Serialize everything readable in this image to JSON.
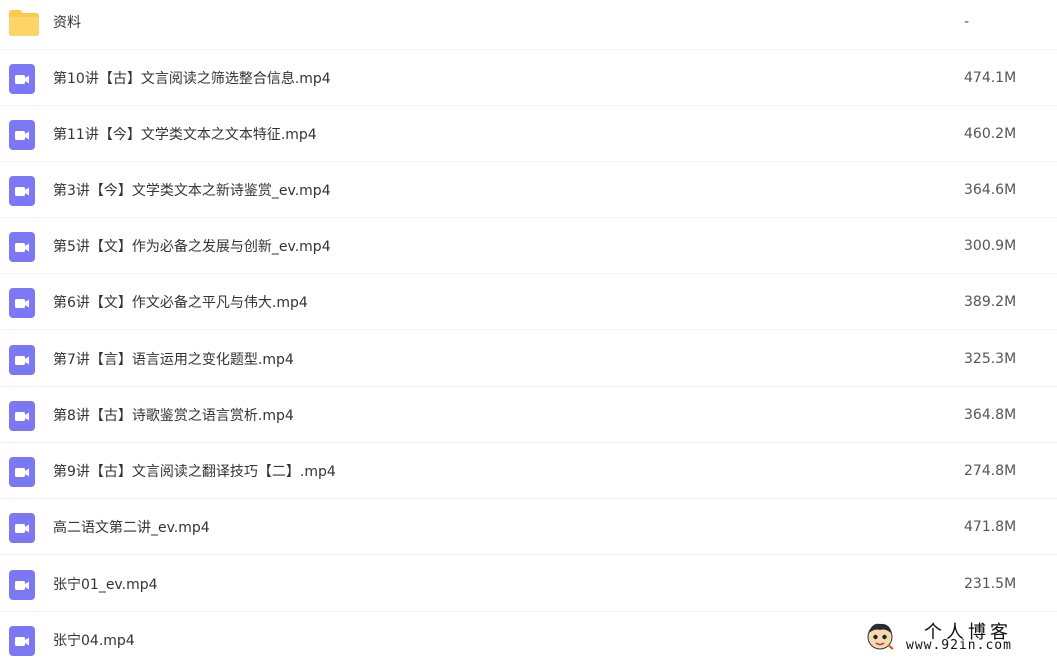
{
  "colors": {
    "folder": "#fcc94a",
    "video_icon": "#7b77f5",
    "divider": "#f0f1f3"
  },
  "files": [
    {
      "name": "资料",
      "size": "-",
      "icon": "folder-icon"
    },
    {
      "name": "第10讲【古】文言阅读之筛选整合信息.mp4",
      "size": "474.1M",
      "icon": "video-file-icon"
    },
    {
      "name": "第11讲【今】文学类文本之文本特征.mp4",
      "size": "460.2M",
      "icon": "video-file-icon"
    },
    {
      "name": "第3讲【今】文学类文本之新诗鉴赏_ev.mp4",
      "size": "364.6M",
      "icon": "video-file-icon"
    },
    {
      "name": "第5讲【文】作为必备之发展与创新_ev.mp4",
      "size": "300.9M",
      "icon": "video-file-icon"
    },
    {
      "name": "第6讲【文】作文必备之平凡与伟大.mp4",
      "size": "389.2M",
      "icon": "video-file-icon"
    },
    {
      "name": "第7讲【言】语言运用之变化题型.mp4",
      "size": "325.3M",
      "icon": "video-file-icon"
    },
    {
      "name": "第8讲【古】诗歌鉴赏之语言赏析.mp4",
      "size": "364.8M",
      "icon": "video-file-icon"
    },
    {
      "name": "第9讲【古】文言阅读之翻译技巧【二】.mp4",
      "size": "274.8M",
      "icon": "video-file-icon"
    },
    {
      "name": "高二语文第二讲_ev.mp4",
      "size": "471.8M",
      "icon": "video-file-icon"
    },
    {
      "name": "张宁01_ev.mp4",
      "size": "231.5M",
      "icon": "video-file-icon"
    },
    {
      "name": "张宁04.mp4",
      "size": "",
      "icon": "video-file-icon"
    }
  ],
  "watermark": {
    "title": "个人博客",
    "url": "www.92in.com"
  }
}
